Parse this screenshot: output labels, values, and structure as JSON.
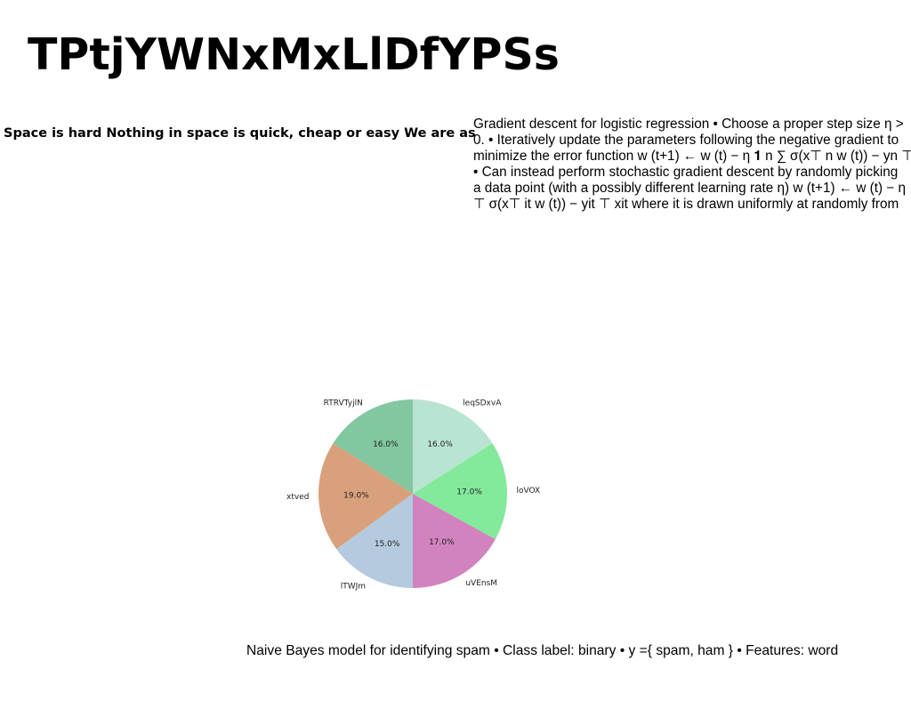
{
  "title": "TPtjYWNxMxLlDfYPSs",
  "left_text": "Space is hard Nothing in space is quick, cheap or easy We are as",
  "right_text": {
    "lines": [
      "Gradient descent for logistic regression • Choose a proper step size η >",
      "0. • Iteratively update the parameters following the negative gradient to",
      "minimize the error function w (t+1) ← w (t) − η 𝟏 n ∑ σ(x⊤ n w (t)) − yn ⊤",
      "• Can instead perform stochastic gradient descent by randomly picking",
      "a data point (with a possibly different learning rate η) w (t+1) ← w (t) − η",
      "⊤ σ(x⊤ it w (t)) − yit ⊤ xit where it is drawn uniformly at randomly from"
    ]
  },
  "caption": "Naive Bayes model for identifying spam • Class label: binary • y ={ spam, ham } • Features: word",
  "chart_data": {
    "type": "pie",
    "start": "top, counterclockwise",
    "labels": [
      "RTRVTyjlN",
      "xtved",
      "lTWJm",
      "uVEnsM",
      "loVOX",
      "leqSDxvA"
    ],
    "values": [
      16.0,
      19.0,
      15.0,
      17.0,
      17.0,
      16.0
    ],
    "pct_labels": [
      "16.0%",
      "19.0%",
      "15.0%",
      "17.0%",
      "17.0%",
      "16.0%"
    ],
    "colors": [
      "#82c79f",
      "#d9a07c",
      "#b4cadf",
      "#d283bf",
      "#83e99b",
      "#b9e4d1"
    ]
  }
}
